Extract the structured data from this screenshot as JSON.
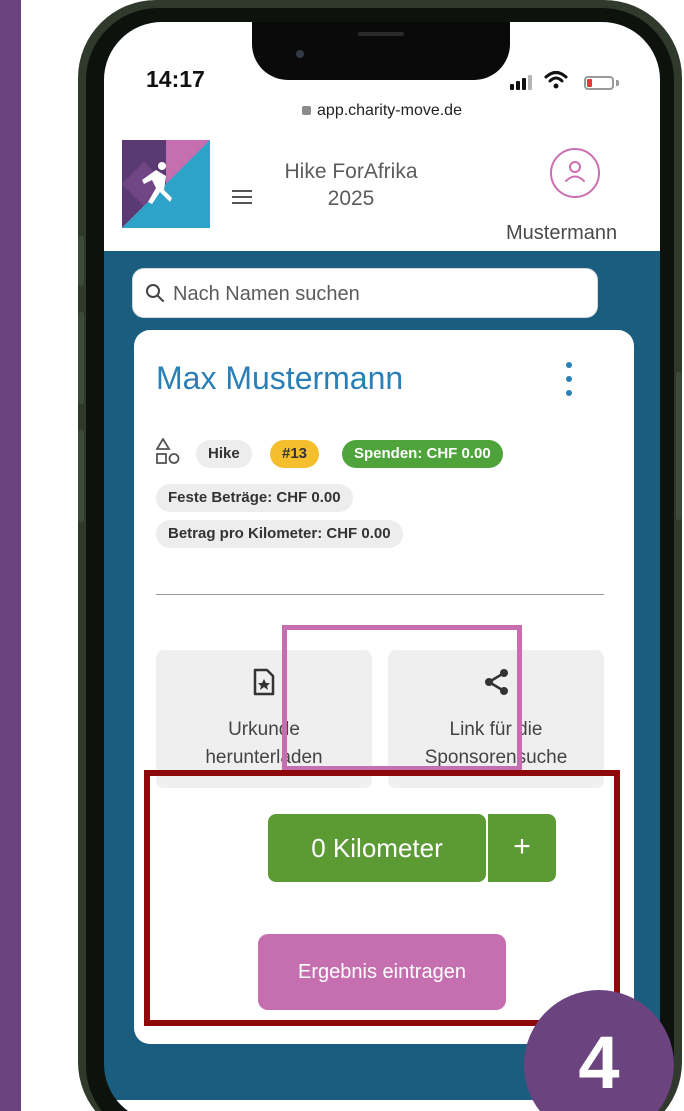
{
  "status_bar": {
    "time": "14:17",
    "url": "app.charity-move.de"
  },
  "header": {
    "event_title_line1": "Hike ForAfrika",
    "event_title_line2": "2025",
    "user_name": "Mustermann"
  },
  "search": {
    "placeholder": "Nach Namen suchen"
  },
  "participant": {
    "name": "Max Mustermann",
    "chips": {
      "sport": "Hike",
      "number": "#13",
      "donations": "Spenden: CHF 0.00",
      "fixed_amounts": "Feste Beträge: CHF 0.00",
      "per_km": "Betrag pro Kilometer: CHF 0.00"
    }
  },
  "actions": {
    "certificate_line1": "Urkunde",
    "certificate_line2": "herunterladen",
    "sponsor_link_line1": "Link für die",
    "sponsor_link_line2": "Sponsorensuche"
  },
  "tracking": {
    "kilometers_label": "0 Kilometer",
    "add_label": "+",
    "submit_result": "Ergebnis eintragen"
  },
  "step_number": "4",
  "colors": {
    "brand_purple": "#6b437e",
    "accent_pink": "#c66fb0",
    "highlight_red": "#8e0a0a",
    "name_blue": "#2a7fb6",
    "km_green": "#5c9a34",
    "donation_green": "#4ea33b",
    "number_yellow": "#f5be2d",
    "screen_blue": "#1b5d7e"
  },
  "icons": [
    "lock-icon",
    "menu-icon",
    "user-icon",
    "search-icon",
    "more-vertical-icon",
    "shapes-icon",
    "certificate-icon",
    "share-icon"
  ]
}
